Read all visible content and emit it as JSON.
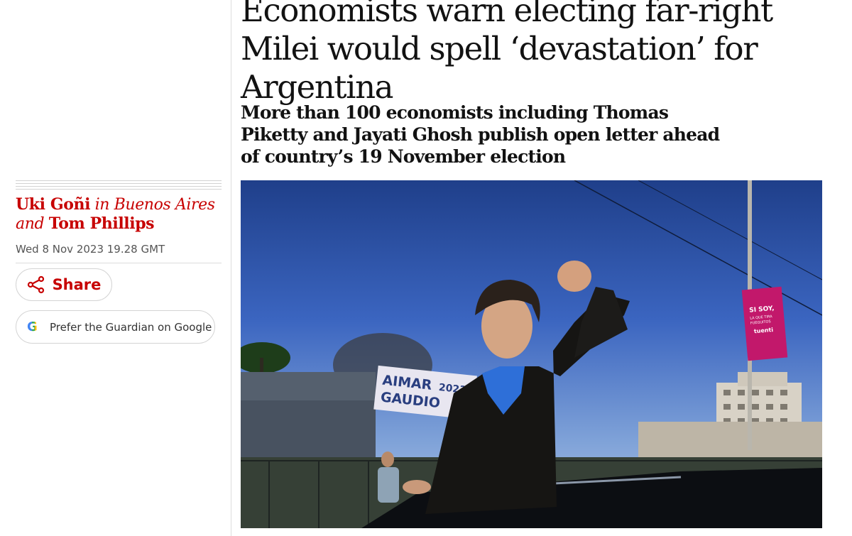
{
  "article": {
    "headline": "Economists warn electing far-right Milei would spell ‘devastation’ for Argentina",
    "standfirst": "More than 100 economists including Thomas Piketty and Jayati Ghosh publish open letter ahead of country’s 19 November election",
    "byline": {
      "author1": "Uki Goñi",
      "location": " in Buenos Aires",
      "conjunction": "and ",
      "author2": "Tom Phillips"
    },
    "dateline": "Wed 8 Nov 2023 19.28 GMT"
  },
  "actions": {
    "share_label": "Share",
    "share_icon": "share-icon",
    "google_label": "Prefer the Guardian on Google",
    "google_icon": "google-g-icon"
  },
  "photo": {
    "banner_text_line1": "AIMAR",
    "banner_text_line1b": "2023",
    "banner_text_line2": "GAUDIO",
    "sign_line1": "SI SOY,",
    "sign_line2": "LA QUE TIRA",
    "sign_line3": "FUEGUITOS",
    "sign_brand": "tuenti"
  },
  "colors": {
    "accent": "#c70000",
    "text": "#121212",
    "meta_text": "#555555",
    "border": "#dcdcdc"
  }
}
